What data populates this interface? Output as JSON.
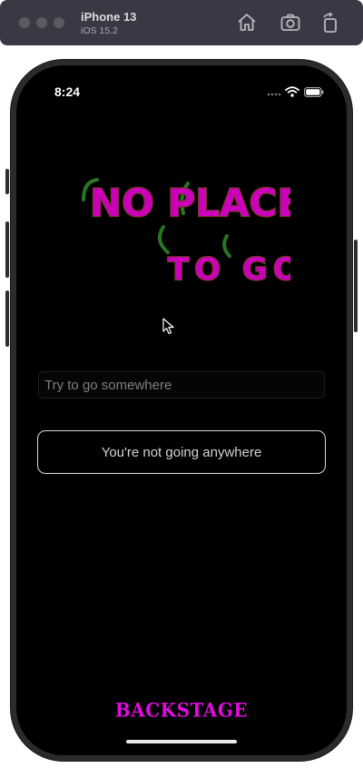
{
  "simulator": {
    "device_name": "iPhone 13",
    "os_version": "iOS 15.2"
  },
  "status_bar": {
    "time": "8:24"
  },
  "logo": {
    "line1": "NO PLACE",
    "line2": "TO GO",
    "text_color": "#cc00bb",
    "outline_color": "#6b3a1a",
    "accent_color": "#2f8a2a"
  },
  "search": {
    "placeholder": "Try to go somewhere",
    "value": ""
  },
  "main_button": {
    "label": "You're not going anywhere"
  },
  "footer": {
    "brand": "BACKSTAGE",
    "brand_color": "#e20ae0"
  },
  "icons": [
    "home-icon",
    "screenshot-icon",
    "rotate-icon",
    "wifi-icon",
    "battery-icon",
    "signal-icon",
    "cursor-icon"
  ]
}
